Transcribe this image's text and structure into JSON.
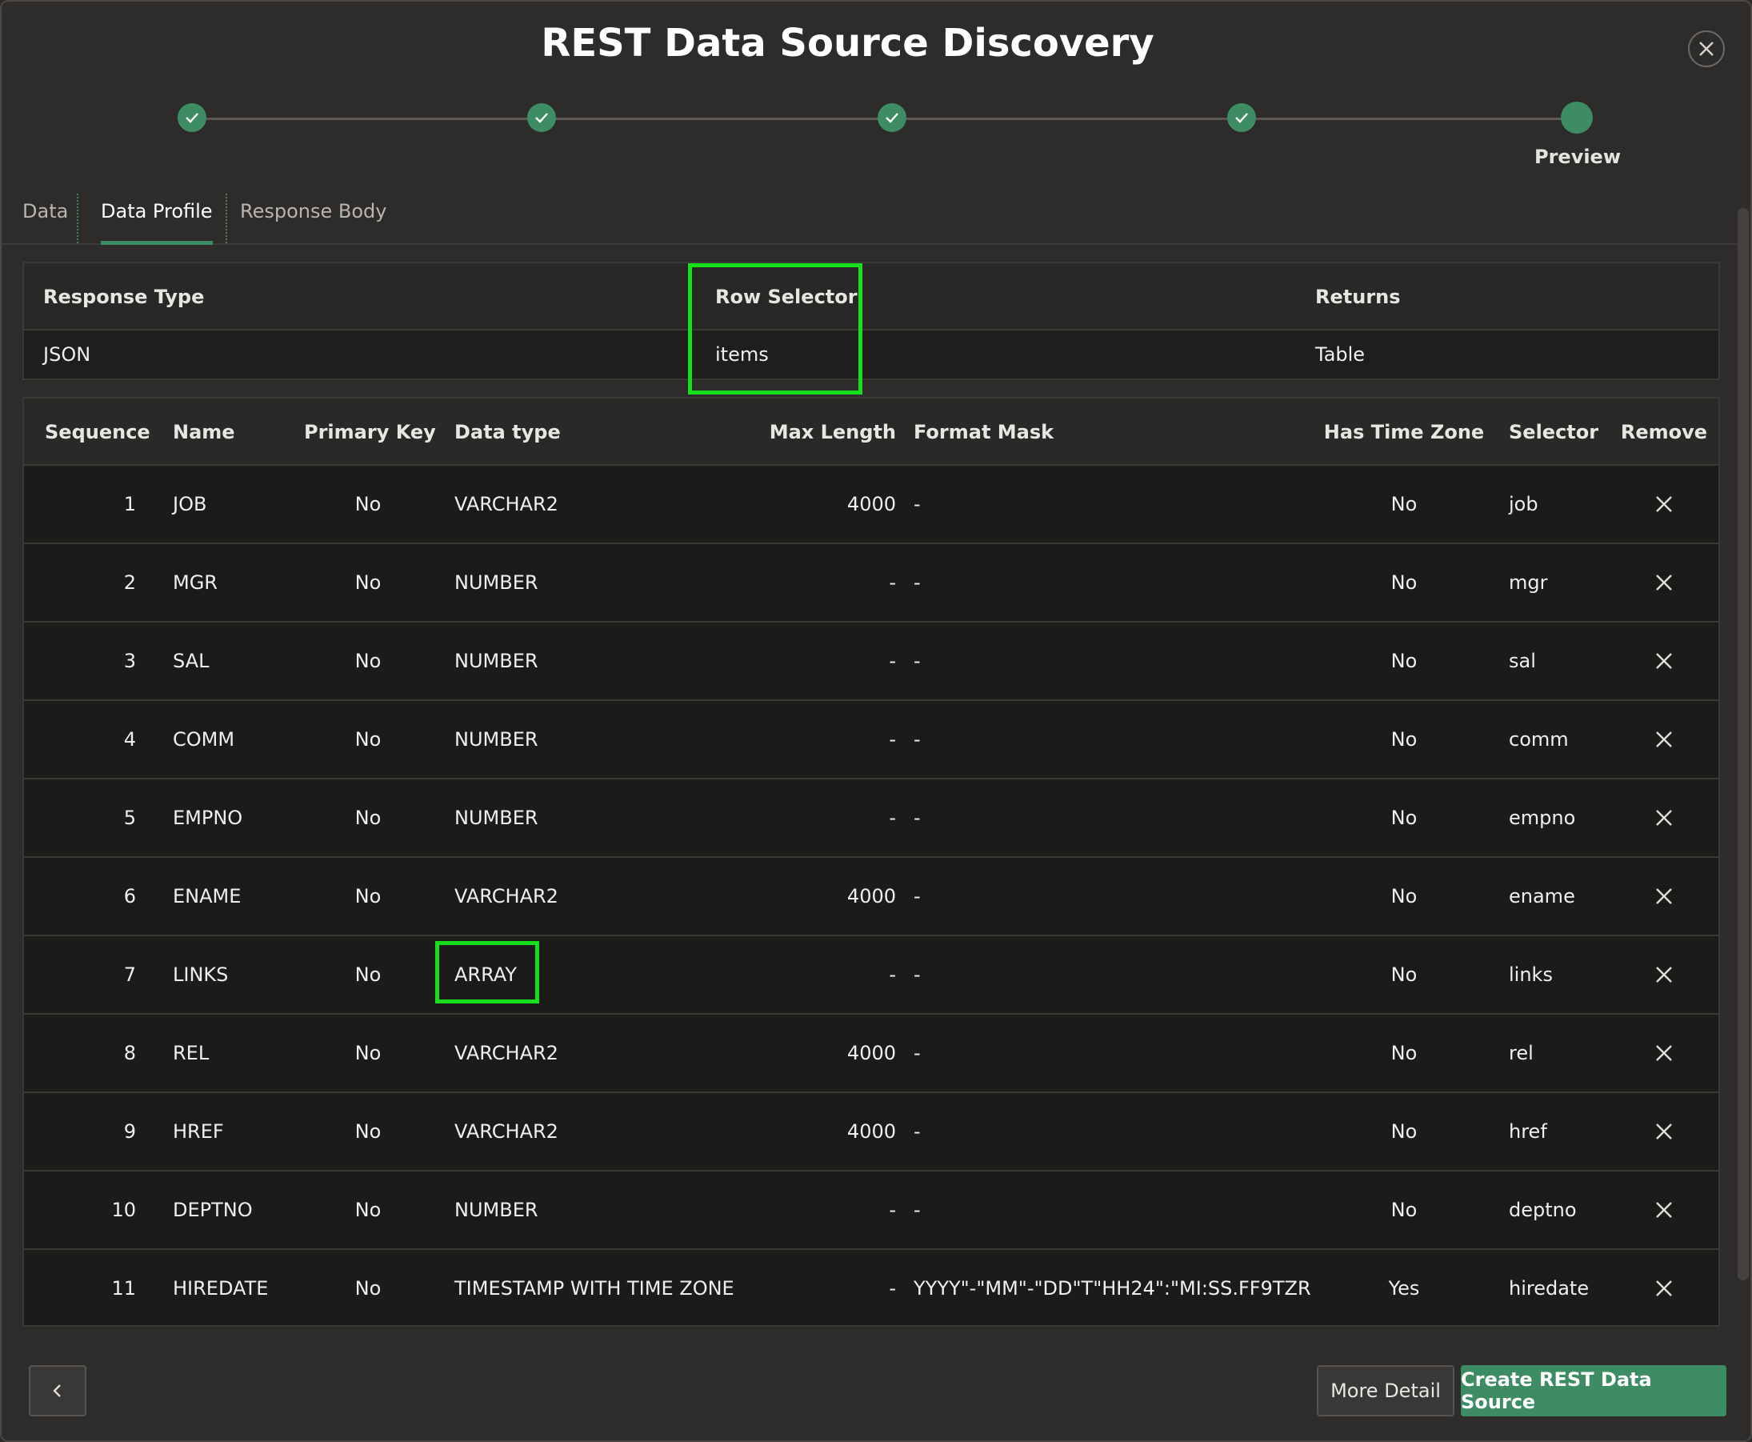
{
  "dialog": {
    "title": "REST Data Source Discovery",
    "close_icon": "close-icon"
  },
  "wizard": {
    "steps": [
      {
        "state": "complete",
        "icon": "check-icon"
      },
      {
        "state": "complete",
        "icon": "check-icon"
      },
      {
        "state": "complete",
        "icon": "check-icon"
      },
      {
        "state": "complete",
        "icon": "check-icon"
      },
      {
        "state": "current"
      }
    ],
    "current_label": "Preview"
  },
  "tabs": [
    {
      "label": "Data",
      "active": false
    },
    {
      "label": "Data Profile",
      "active": true
    },
    {
      "label": "Response Body",
      "active": false
    }
  ],
  "profile": {
    "headers": {
      "response_type": "Response Type",
      "row_selector": "Row Selector",
      "returns": "Returns"
    },
    "values": {
      "response_type": "JSON",
      "row_selector": "items",
      "returns": "Table"
    }
  },
  "columns_table": {
    "headers": {
      "sequence": "Sequence",
      "name": "Name",
      "primary_key": "Primary Key",
      "data_type": "Data type",
      "max_length": "Max Length",
      "format_mask": "Format Mask",
      "has_time_zone": "Has Time Zone",
      "selector": "Selector",
      "remove": "Remove"
    },
    "rows": [
      {
        "sequence": "1",
        "name": "JOB",
        "primary_key": "No",
        "data_type": "VARCHAR2",
        "max_length": "4000",
        "format_mask": "-",
        "has_time_zone": "No",
        "selector": "job"
      },
      {
        "sequence": "2",
        "name": "MGR",
        "primary_key": "No",
        "data_type": "NUMBER",
        "max_length": "-",
        "format_mask": "-",
        "has_time_zone": "No",
        "selector": "mgr"
      },
      {
        "sequence": "3",
        "name": "SAL",
        "primary_key": "No",
        "data_type": "NUMBER",
        "max_length": "-",
        "format_mask": "-",
        "has_time_zone": "No",
        "selector": "sal"
      },
      {
        "sequence": "4",
        "name": "COMM",
        "primary_key": "No",
        "data_type": "NUMBER",
        "max_length": "-",
        "format_mask": "-",
        "has_time_zone": "No",
        "selector": "comm"
      },
      {
        "sequence": "5",
        "name": "EMPNO",
        "primary_key": "No",
        "data_type": "NUMBER",
        "max_length": "-",
        "format_mask": "-",
        "has_time_zone": "No",
        "selector": "empno"
      },
      {
        "sequence": "6",
        "name": "ENAME",
        "primary_key": "No",
        "data_type": "VARCHAR2",
        "max_length": "4000",
        "format_mask": "-",
        "has_time_zone": "No",
        "selector": "ename"
      },
      {
        "sequence": "7",
        "name": "LINKS",
        "primary_key": "No",
        "data_type": "ARRAY",
        "max_length": "-",
        "format_mask": "-",
        "has_time_zone": "No",
        "selector": "links"
      },
      {
        "sequence": "8",
        "name": "REL",
        "primary_key": "No",
        "data_type": "VARCHAR2",
        "max_length": "4000",
        "format_mask": "-",
        "has_time_zone": "No",
        "selector": "rel"
      },
      {
        "sequence": "9",
        "name": "HREF",
        "primary_key": "No",
        "data_type": "VARCHAR2",
        "max_length": "4000",
        "format_mask": "-",
        "has_time_zone": "No",
        "selector": "href"
      },
      {
        "sequence": "10",
        "name": "DEPTNO",
        "primary_key": "No",
        "data_type": "NUMBER",
        "max_length": "-",
        "format_mask": "-",
        "has_time_zone": "No",
        "selector": "deptno"
      },
      {
        "sequence": "11",
        "name": "HIREDATE",
        "primary_key": "No",
        "data_type": "TIMESTAMP WITH TIME ZONE",
        "max_length": "-",
        "format_mask": "YYYY\"-\"MM\"-\"DD\"T\"HH24\":\"MI:SS.FF9TZR",
        "has_time_zone": "Yes",
        "selector": "hiredate"
      }
    ]
  },
  "footer": {
    "back_icon": "chevron-left-icon",
    "more_detail_label": "More Detail",
    "create_label": "Create REST Data Source"
  },
  "colors": {
    "accent": "#3e8c64",
    "highlight": "#16e01a",
    "background": "#2e2c2a"
  }
}
